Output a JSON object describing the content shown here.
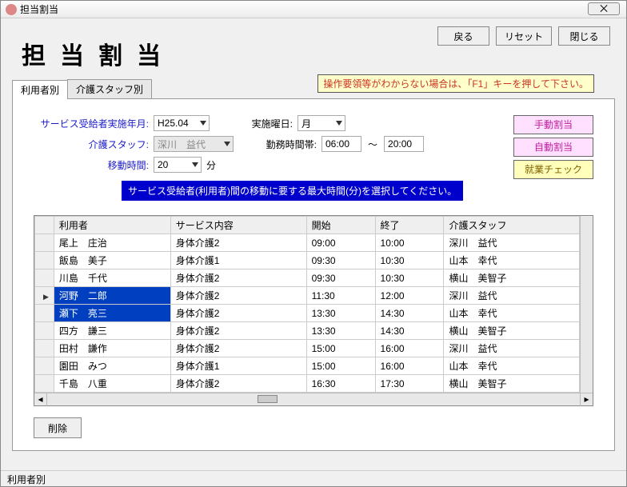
{
  "window": {
    "title": "担当割当",
    "close_glyph": "⨉"
  },
  "buttons": {
    "back": "戻る",
    "reset": "リセット",
    "close": "閉じる",
    "delete": "削除"
  },
  "heading": "担当割当",
  "hint": "操作要領等がわからない場合は、「F1」キーを押して下さい。",
  "tabs": {
    "byUser": "利用者別",
    "byStaff": "介護スタッフ別"
  },
  "form": {
    "periodLabel": "サービス受給者実施年月:",
    "periodValue": "H25.04",
    "dayLabel": "実施曜日:",
    "dayValue": "月",
    "staffLabel": "介護スタッフ:",
    "staffValue": "深川　益代",
    "hoursLabel": "勤務時間帯:",
    "hoursFrom": "06:00",
    "hoursSep": "～",
    "hoursTo": "20:00",
    "moveLabel": "移動時間:",
    "moveValue": "20",
    "moveUnit": "分"
  },
  "banner": "サービス受給者(利用者)間の移動に要する最大時間(分)を選択してください。",
  "sideButtons": {
    "manual": "手動割当",
    "auto": "自動割当",
    "check": "就業チェック"
  },
  "grid": {
    "cols": {
      "user": "利用者",
      "service": "サービス内容",
      "start": "開始",
      "end": "終了",
      "staff": "介護スタッフ"
    },
    "rows": [
      {
        "user": "尾上　庄治",
        "service": "身体介護2",
        "start": "09:00",
        "end": "10:00",
        "staff": "深川　益代"
      },
      {
        "user": "飯島　美子",
        "service": "身体介護1",
        "start": "09:30",
        "end": "10:30",
        "staff": "山本　幸代"
      },
      {
        "user": "川島　千代",
        "service": "身体介護2",
        "start": "09:30",
        "end": "10:30",
        "staff": "横山　美智子"
      },
      {
        "user": "河野　二郎",
        "service": "身体介護2",
        "start": "11:30",
        "end": "12:00",
        "staff": "深川　益代",
        "sel": true,
        "ptr": true
      },
      {
        "user": "瀬下　亮三",
        "service": "身体介護2",
        "start": "13:30",
        "end": "14:30",
        "staff": "山本　幸代",
        "sel": true
      },
      {
        "user": "四方　謙三",
        "service": "身体介護2",
        "start": "13:30",
        "end": "14:30",
        "staff": "横山　美智子"
      },
      {
        "user": "田村　謙作",
        "service": "身体介護2",
        "start": "15:00",
        "end": "16:00",
        "staff": "深川　益代"
      },
      {
        "user": "園田　みつ",
        "service": "身体介護1",
        "start": "15:00",
        "end": "16:00",
        "staff": "山本　幸代"
      },
      {
        "user": "千島　八重",
        "service": "身体介護2",
        "start": "16:30",
        "end": "17:30",
        "staff": "横山　美智子"
      }
    ]
  },
  "status": "利用者別"
}
